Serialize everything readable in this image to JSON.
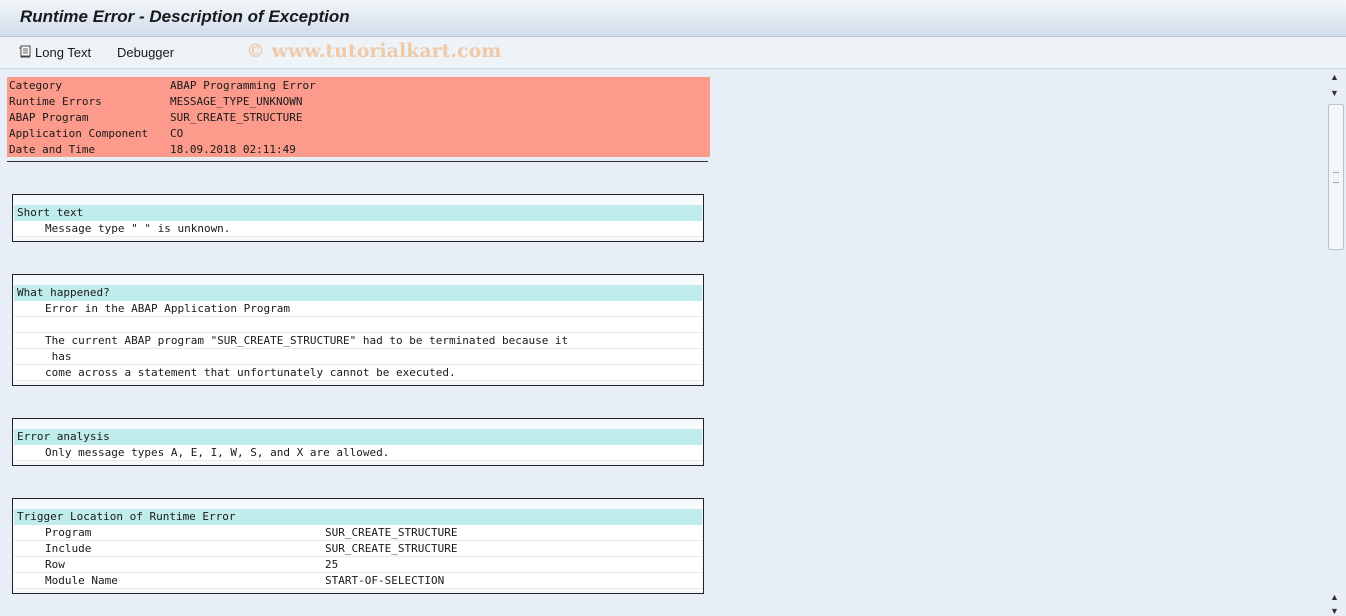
{
  "window": {
    "title": "Runtime Error - Description of Exception"
  },
  "toolbar": {
    "long_text_label": "Long Text",
    "debugger_label": "Debugger",
    "watermark": "© www.tutorialkart.com"
  },
  "header": {
    "rows": [
      {
        "key": "Category",
        "value": "ABAP Programming Error"
      },
      {
        "key": "Runtime Errors",
        "value": "MESSAGE_TYPE_UNKNOWN"
      },
      {
        "key": "ABAP Program",
        "value": "SUR_CREATE_STRUCTURE"
      },
      {
        "key": "Application Component",
        "value": "CO"
      },
      {
        "key": "Date and Time",
        "value": "18.09.2018 02:11:49"
      }
    ]
  },
  "sections": {
    "short_text": {
      "title": "Short text",
      "lines": [
        "Message type \" \" is unknown."
      ]
    },
    "what_happened": {
      "title": "What happened?",
      "lines": [
        "Error in the ABAP Application Program",
        "",
        "The current ABAP program \"SUR_CREATE_STRUCTURE\" had to be terminated because it",
        " has",
        "come across a statement that unfortunately cannot be executed."
      ]
    },
    "error_analysis": {
      "title": "Error analysis",
      "lines": [
        "Only message types A, E, I, W, S, and X are allowed."
      ]
    },
    "trigger_location": {
      "title": "Trigger Location of Runtime Error",
      "rows": [
        {
          "key": "Program",
          "value": "SUR_CREATE_STRUCTURE"
        },
        {
          "key": "Include",
          "value": "SUR_CREATE_STRUCTURE"
        },
        {
          "key": "Row",
          "value": "25"
        },
        {
          "key": "Module Name",
          "value": "START-OF-SELECTION"
        }
      ]
    }
  },
  "icons": {
    "long_text": "long-text-icon",
    "scroll_up": "scroll-up-icon",
    "scroll_down": "scroll-down-icon"
  }
}
